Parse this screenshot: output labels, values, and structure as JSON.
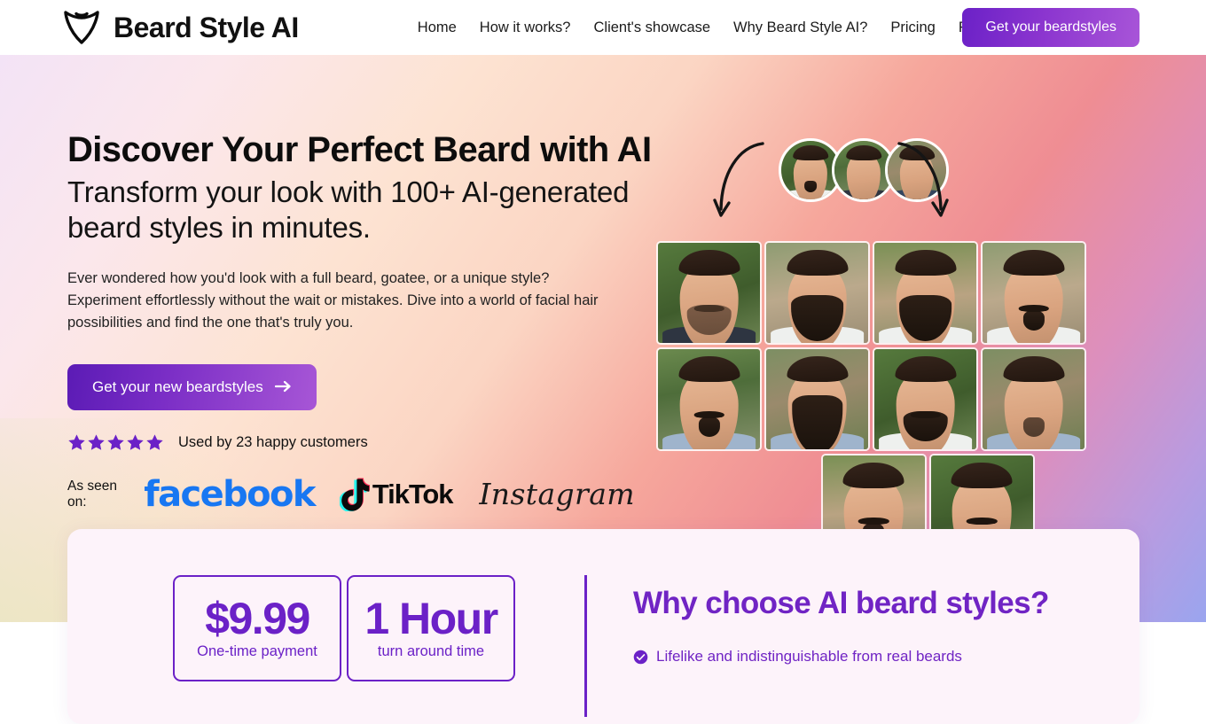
{
  "header": {
    "brand_name": "Beard Style AI",
    "logo_icon": "beard-shield-icon",
    "nav": [
      {
        "label": "Home"
      },
      {
        "label": "How it works?"
      },
      {
        "label": "Client's showcase"
      },
      {
        "label": "Why Beard Style AI?"
      },
      {
        "label": "Pricing"
      },
      {
        "label": "FAQ"
      }
    ],
    "cta_label": "Get your beardstyles"
  },
  "hero": {
    "headline": "Discover Your Perfect Beard with AI",
    "subhead": "Transform your look with 100+ AI-generated beard styles in minutes.",
    "blurb": "Ever wondered how you'd look with a full beard, goatee, or a unique style? Experiment effortlessly without the wait or mistakes. Dive into a world of facial hair possibilities and find the one that's truly you.",
    "cta_label": "Get your new beardstyles",
    "cta_arrow_icon": "arrow-right-icon",
    "rating": {
      "stars": 5,
      "star_icon": "star-filled-icon",
      "text": "Used by 23 happy customers"
    },
    "as_seen": {
      "label": "As seen on:",
      "brands": [
        {
          "name": "facebook",
          "color": "#1877F2"
        },
        {
          "name": "TikTok",
          "color": "#0b0b0b"
        },
        {
          "name": "Instagram",
          "color": "#1a1a1a"
        }
      ]
    }
  },
  "showcase": {
    "avatars": [
      {
        "name": "source-photo-1"
      },
      {
        "name": "source-photo-2"
      },
      {
        "name": "source-photo-3"
      }
    ],
    "arrow_icon": "curved-arrow-down-icon",
    "grid": {
      "rows": [
        [
          {
            "name": "beard-result-1",
            "style": "stubble"
          },
          {
            "name": "beard-result-2",
            "style": "full-beard"
          },
          {
            "name": "beard-result-3",
            "style": "full-beard"
          },
          {
            "name": "beard-result-4",
            "style": "goatee"
          }
        ],
        [
          {
            "name": "beard-result-5",
            "style": "goatee"
          },
          {
            "name": "beard-result-6",
            "style": "long-beard"
          },
          {
            "name": "beard-result-7",
            "style": "short-beard"
          },
          {
            "name": "beard-result-8",
            "style": "stubble"
          }
        ],
        [
          {
            "name": "beard-result-9",
            "style": "mustache"
          },
          {
            "name": "beard-result-10",
            "style": "mustache"
          }
        ]
      ]
    }
  },
  "info_card": {
    "stats": [
      {
        "value": "$9.99",
        "label": "One-time payment"
      },
      {
        "value": "1 Hour",
        "label": "turn around time"
      }
    ],
    "why_title": "Why choose AI beard styles?",
    "why_items": [
      {
        "text": "Lifelike and indistinguishable from real beards",
        "icon": "check-circle-icon"
      }
    ]
  },
  "colors": {
    "brand_purple": "#6b21c7",
    "heading_purple": "#7024c4",
    "facebook_blue": "#1877F2",
    "card_bg": "#fdf3fa"
  }
}
